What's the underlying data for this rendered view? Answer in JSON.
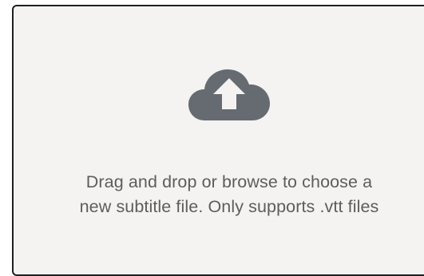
{
  "dropzone": {
    "icon": "cloud-upload-icon",
    "icon_color": "#656b70",
    "background_color": "#f4f3f2",
    "border_color": "#1f1f1f",
    "message_line1": "Drag and drop or browse to choose a",
    "message_line2": "new subtitle file. Only supports .vtt files"
  }
}
